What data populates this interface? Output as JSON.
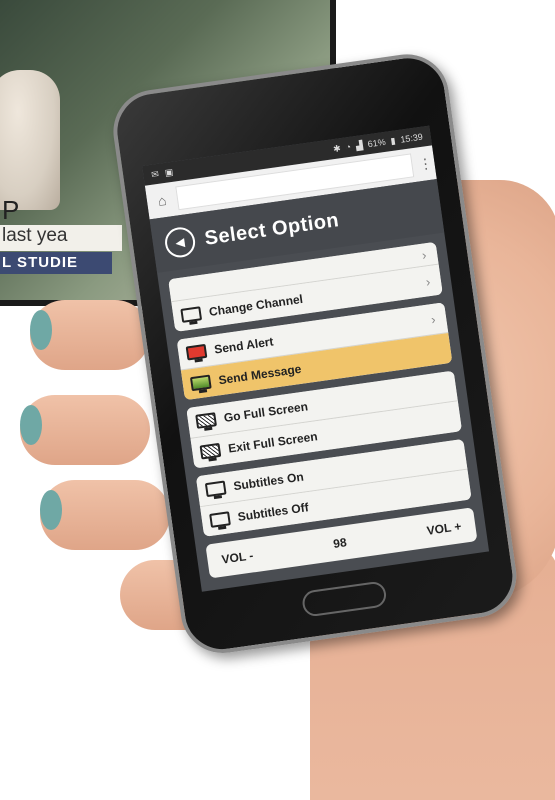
{
  "tv": {
    "letter": "P",
    "caption": "last yea",
    "bar": "L STUDIE"
  },
  "status": {
    "battery": "61%",
    "time": "15:39"
  },
  "browser": {
    "url": ""
  },
  "header": {
    "title": "Select Option"
  },
  "groups": {
    "channel": {
      "items": [
        {
          "label": "",
          "icon": "none"
        },
        {
          "label": "Change Channel",
          "icon": "monitor-icon"
        }
      ]
    },
    "messaging": {
      "items": [
        {
          "label": "Send Alert",
          "icon": "monitor-red-icon"
        },
        {
          "label": "Send Message",
          "icon": "monitor-green-icon",
          "highlighted": true
        }
      ]
    },
    "screen": {
      "items": [
        {
          "label": "Go Full Screen",
          "icon": "fullscreen-icon"
        },
        {
          "label": "Exit Full Screen",
          "icon": "exit-fullscreen-icon"
        }
      ]
    },
    "subtitles": {
      "items": [
        {
          "label": "Subtitles On",
          "icon": "monitor-icon"
        },
        {
          "label": "Subtitles Off",
          "icon": "monitor-icon"
        }
      ]
    }
  },
  "volume": {
    "down_label": "VOL -",
    "value": "98",
    "up_label": "VOL +"
  },
  "colors": {
    "highlight": "#f0c46a",
    "panel_bg": "#4a4d52",
    "nail": "#6fa8a5"
  }
}
